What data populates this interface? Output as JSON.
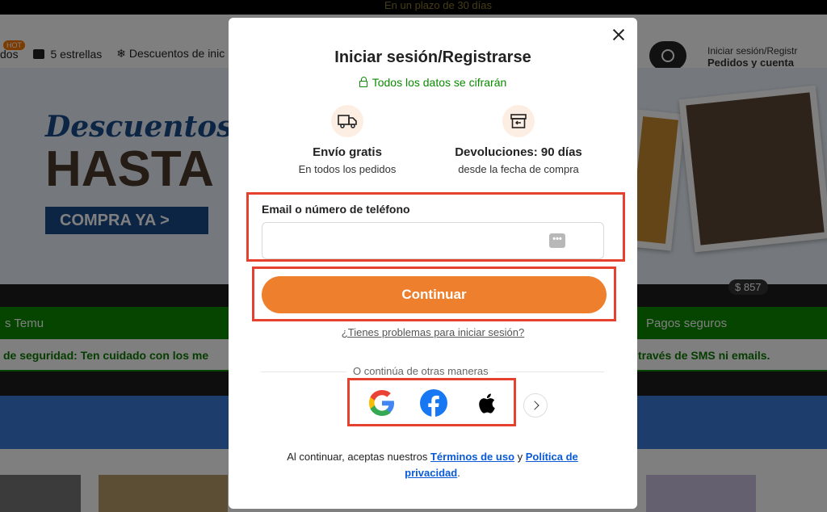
{
  "background": {
    "promo_text": "En un plazo de 30 días",
    "nav": {
      "hot_badge": "HOT",
      "item1": "dos",
      "item2": "5 estrellas",
      "item3": "Descuentos de inic"
    },
    "account": {
      "line1": "Iniciar sesión/Registr",
      "line2": "Pedidos y cuenta"
    },
    "banner": {
      "script_title": "Descuentos de in",
      "big_title": "HASTA",
      "cta": "COMPRA YA >",
      "price": "$ 857"
    },
    "greenbar": {
      "left": "s Temu",
      "right": "Pagos seguros"
    },
    "alert": {
      "left": "de seguridad: Ten cuidado con los me",
      "right": "través de SMS ni emails."
    }
  },
  "modal": {
    "title": "Iniciar sesión/Registrarse",
    "secure_text": "Todos los datos se cifrarán",
    "benefits": [
      {
        "icon": "truck-icon",
        "title": "Envío gratis",
        "subtitle": "En todos los pedidos"
      },
      {
        "icon": "return-box-icon",
        "title": "Devoluciones: 90 días",
        "subtitle": "desde la fecha de compra"
      }
    ],
    "email_label": "Email o número de teléfono",
    "email_value": "",
    "email_placeholder": "",
    "continue_label": "Continuar",
    "trouble_link": "¿Tienes problemas para iniciar sesión?",
    "divider_text": "O continúa de otras maneras",
    "social": [
      {
        "name": "Google"
      },
      {
        "name": "Facebook"
      },
      {
        "name": "Apple"
      }
    ],
    "terms": {
      "prefix": "Al continuar, aceptas nuestros",
      "terms_link": "Términos de uso",
      "and": "y",
      "privacy_link": "Política de privacidad",
      "suffix": "."
    }
  },
  "colors": {
    "accent_orange": "#ed7f2d",
    "secure_green": "#0a8a00",
    "highlight_red": "#e5412e",
    "link_blue": "#0a5ad8"
  }
}
